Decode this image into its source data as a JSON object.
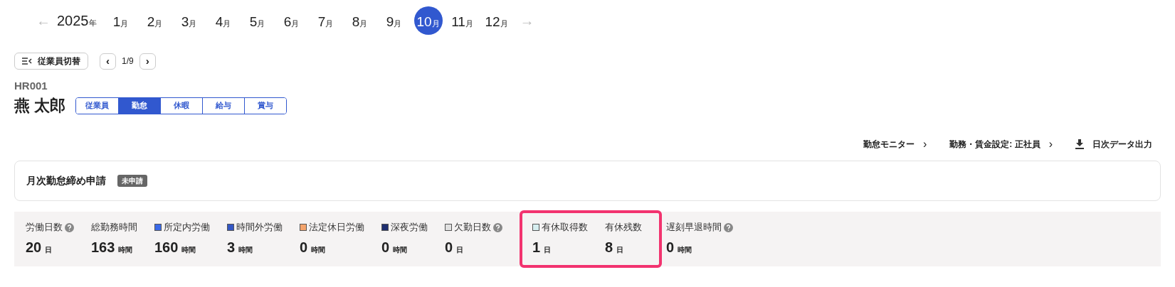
{
  "year_nav": {
    "prev": "←",
    "year": "2025",
    "year_unit": "年",
    "next": "→",
    "months": [
      {
        "num": "1",
        "unit": "月",
        "selected": false
      },
      {
        "num": "2",
        "unit": "月",
        "selected": false
      },
      {
        "num": "3",
        "unit": "月",
        "selected": false
      },
      {
        "num": "4",
        "unit": "月",
        "selected": false
      },
      {
        "num": "5",
        "unit": "月",
        "selected": false
      },
      {
        "num": "6",
        "unit": "月",
        "selected": false
      },
      {
        "num": "7",
        "unit": "月",
        "selected": false
      },
      {
        "num": "8",
        "unit": "月",
        "selected": false
      },
      {
        "num": "9",
        "unit": "月",
        "selected": false
      },
      {
        "num": "10",
        "unit": "月",
        "selected": true
      },
      {
        "num": "11",
        "unit": "月",
        "selected": false
      },
      {
        "num": "12",
        "unit": "月",
        "selected": false
      }
    ]
  },
  "switch_button": "従業員切替",
  "pager": {
    "prev": "‹",
    "page": "1/9",
    "next": "›"
  },
  "employee": {
    "code": "HR001",
    "name": "燕 太郎"
  },
  "tabs": [
    {
      "label": "従業員",
      "selected": false
    },
    {
      "label": "勤怠",
      "selected": true
    },
    {
      "label": "休暇",
      "selected": false
    },
    {
      "label": "給与",
      "selected": false
    },
    {
      "label": "賞与",
      "selected": false
    }
  ],
  "actions": [
    {
      "kind": "link",
      "label": "勤怠モニター",
      "chevron": "›"
    },
    {
      "kind": "link",
      "label": "勤務・賃金設定: 正社員",
      "chevron": "›"
    },
    {
      "kind": "download",
      "label": "日次データ出力"
    }
  ],
  "closing_card": {
    "title": "月次勤怠締め申請",
    "status": "未申請"
  },
  "stats": [
    {
      "label": "労働日数",
      "value": "20",
      "unit": "日",
      "help": true,
      "highlighted": false
    },
    {
      "label": "総勤務時間",
      "value": "163",
      "unit": "時間",
      "help": false,
      "highlighted": false
    },
    {
      "label": "所定内労働",
      "value": "160",
      "unit": "時間",
      "color": "#3b6ae8",
      "help": false,
      "highlighted": false
    },
    {
      "label": "時間外労働",
      "value": "3",
      "unit": "時間",
      "color": "#3457c4",
      "help": false,
      "highlighted": false
    },
    {
      "label": "法定休日労働",
      "value": "0",
      "unit": "時間",
      "color": "#f4a46c",
      "help": false,
      "highlighted": false
    },
    {
      "label": "深夜労働",
      "value": "0",
      "unit": "時間",
      "color": "#1f2f70",
      "help": false,
      "highlighted": false
    },
    {
      "label": "欠勤日数",
      "value": "0",
      "unit": "日",
      "color": "#e0e0e0",
      "help": true,
      "highlighted": false
    },
    {
      "label": "有休取得数",
      "value": "1",
      "unit": "日",
      "color": "#d6eef0",
      "help": false,
      "highlighted": true
    },
    {
      "label": "有休残数",
      "value": "8",
      "unit": "日",
      "help": false,
      "highlighted": true
    },
    {
      "label": "遅刻早退時間",
      "value": "0",
      "unit": "時間",
      "help": true,
      "highlighted": false
    }
  ]
}
